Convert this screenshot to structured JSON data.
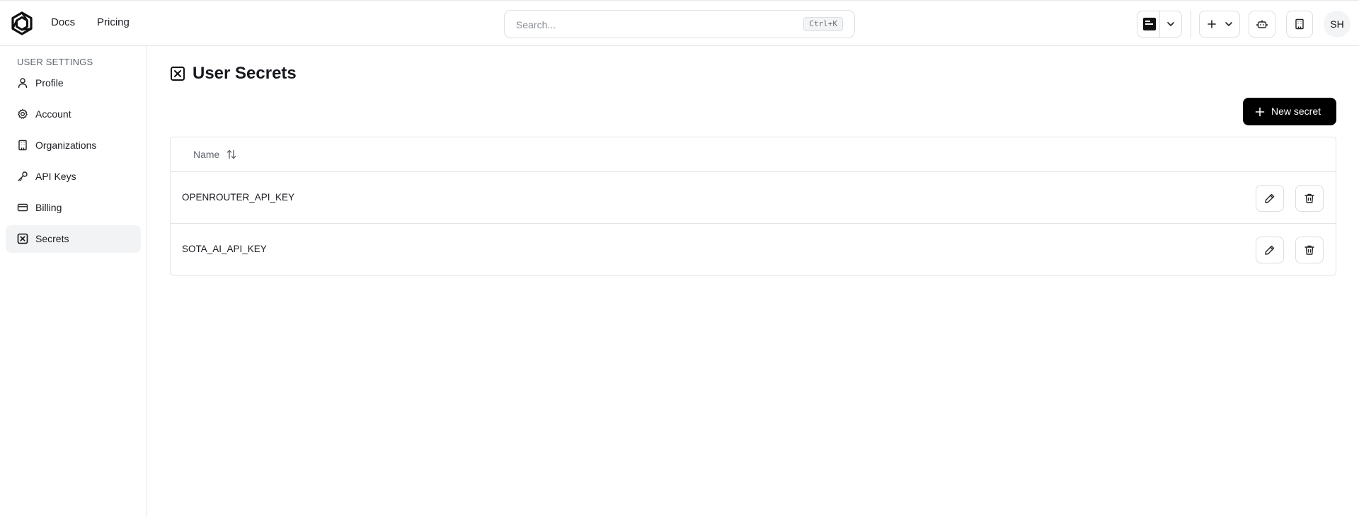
{
  "header": {
    "nav": {
      "docs": "Docs",
      "pricing": "Pricing"
    },
    "search": {
      "placeholder": "Search...",
      "shortcut": "Ctrl+K",
      "value": ""
    },
    "avatar_initials": "SH"
  },
  "sidebar": {
    "section_title": "USER SETTINGS",
    "items": [
      {
        "label": "Profile",
        "icon": "user-icon",
        "active": false
      },
      {
        "label": "Account",
        "icon": "gear-icon",
        "active": false
      },
      {
        "label": "Organizations",
        "icon": "building-icon",
        "active": false
      },
      {
        "label": "API Keys",
        "icon": "key-icon",
        "active": false
      },
      {
        "label": "Billing",
        "icon": "credit-card-icon",
        "active": false
      },
      {
        "label": "Secrets",
        "icon": "secret-box-icon",
        "active": true
      }
    ]
  },
  "main": {
    "title": "User Secrets",
    "new_button_label": "New secret",
    "table": {
      "columns": [
        "Name"
      ],
      "rows": [
        {
          "name": "OPENROUTER_API_KEY"
        },
        {
          "name": "SOTA_AI_API_KEY"
        }
      ]
    }
  },
  "colors": {
    "primary_button": "#000000",
    "active_sidebar_bg": "#f2f3f5",
    "border": "#e2e4e7",
    "muted_text": "#5f6570"
  }
}
